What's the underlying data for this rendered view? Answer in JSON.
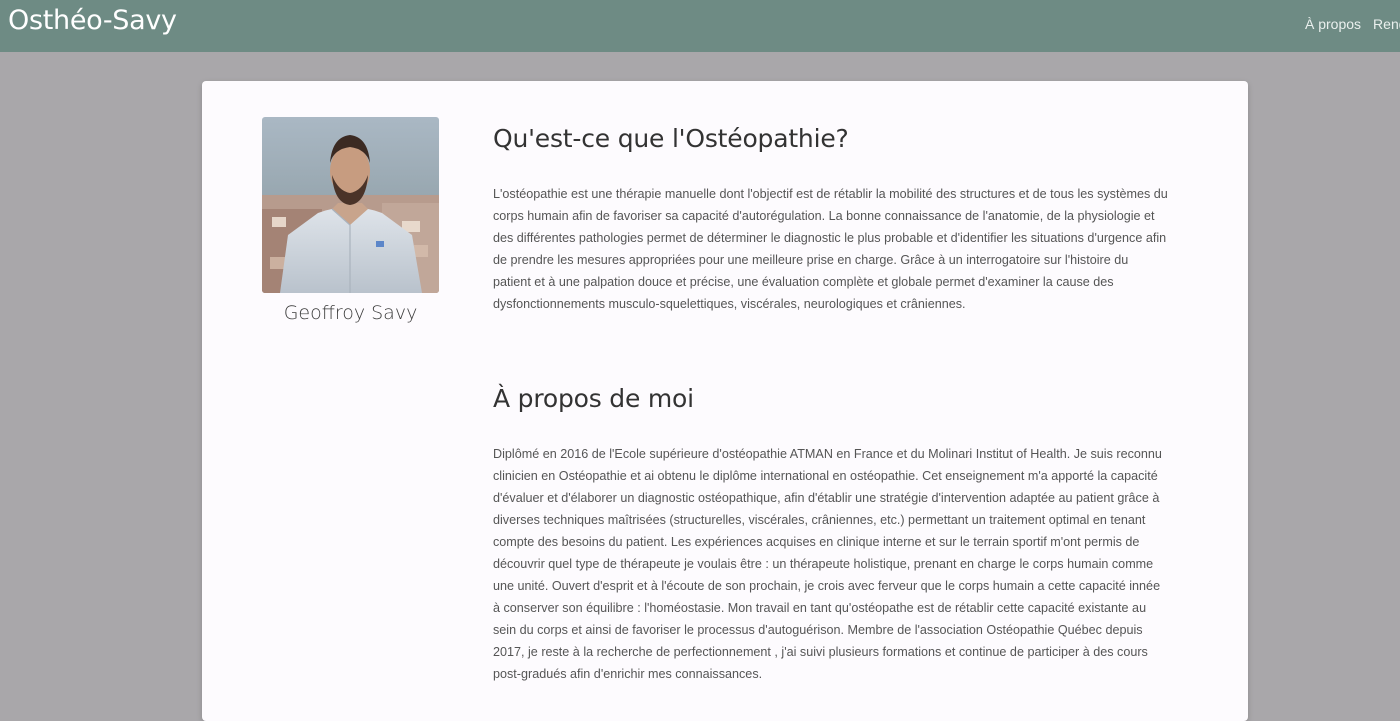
{
  "navbar": {
    "brand": "Osthéo-Savy",
    "links": [
      "À propos",
      "Rende"
    ]
  },
  "profile": {
    "name": "Geoffroy Savy"
  },
  "sections": [
    {
      "title": "Qu'est-ce que l'Ostéopathie?",
      "text": "L'ostéopathie est une thérapie manuelle dont l'objectif est de rétablir la mobilité des structures et de tous les systèmes du corps humain afin de favoriser sa capacité d'autorégulation. La bonne connaissance de l'anatomie, de la physiologie et des différentes pathologies permet de déterminer le diagnostic le plus probable et d'identifier les situations d'urgence afin de prendre les mesures appropriées pour une meilleure prise en charge. Grâce à un interrogatoire sur l'histoire du patient et à une palpation douce et précise, une évaluation complète et globale permet d'examiner la cause des dysfonctionnements musculo-squelettiques, viscérales, neurologiques et crâniennes."
    },
    {
      "title": "À propos de moi",
      "text": "Diplômé en 2016 de l'Ecole supérieure d'ostéopathie ATMAN en France et du Molinari Institut of Health. Je suis reconnu clinicien en Ostéopathie et ai obtenu le diplôme international en ostéopathie. Cet enseignement m'a apporté la capacité d'évaluer et d'élaborer un diagnostic ostéopathique, afin d'établir une stratégie d'intervention adaptée au patient grâce à diverses techniques maîtrisées (structurelles, viscérales, crâniennes, etc.) permettant un traitement optimal en tenant compte des besoins du patient. Les expériences acquises en clinique interne et sur le terrain sportif m'ont permis de découvrir quel type de thérapeute je voulais être : un thérapeute holistique, prenant en charge le corps humain comme une unité. Ouvert d'esprit et à l'écoute de son prochain, je crois avec ferveur que le corps humain a cette capacité innée à conserver son équilibre : l'homéostasie. Mon travail en tant qu'ostéopathe est de rétablir cette capacité existante au sein du corps et ainsi de favoriser le processus d'autoguérison. Membre de l'association Ostéopathie Québec depuis 2017, je reste à la recherche de perfectionnement , j'ai suivi plusieurs formations et continue de participer à des cours post-gradués afin d'enrichir mes connaissances."
    }
  ],
  "colors": {
    "navbar_bg": "#6e8b84",
    "page_bg": "#a9a7aa",
    "card_bg": "#fdfbfe"
  },
  "icons": {
    "profile_photo": "portrait-photo"
  }
}
